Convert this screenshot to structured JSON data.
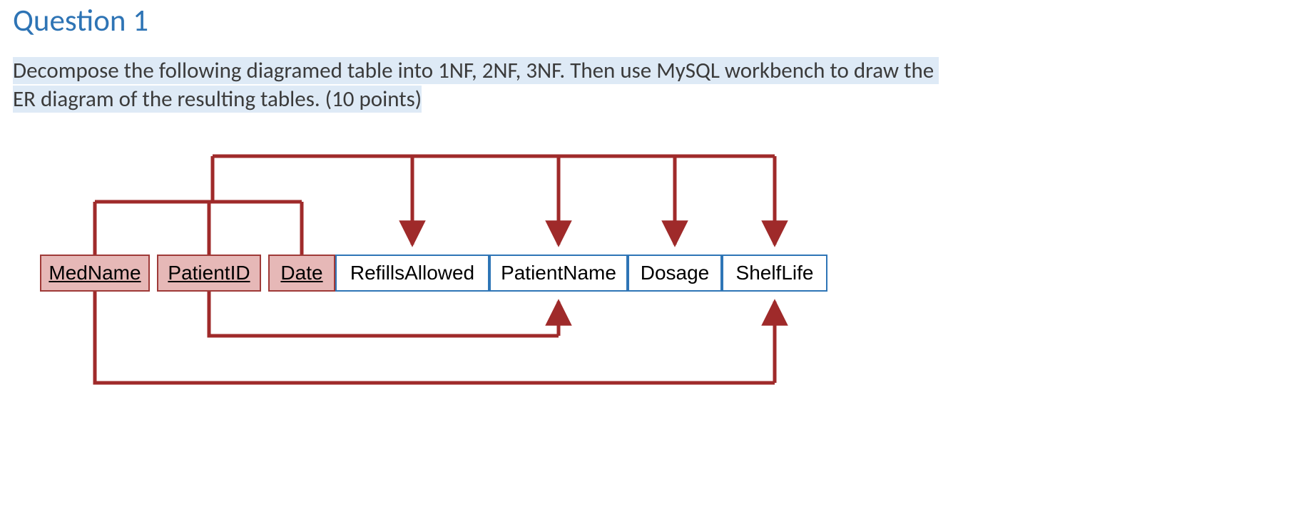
{
  "title": "Question 1",
  "prompt_line1": "Decompose the following diagramed table into 1NF, 2NF, 3NF. Then use MySQL workbench to draw the ",
  "prompt_line2a": "ER diagram of the resulting tables. (10 points)",
  "cells": {
    "medname": {
      "label": "MedName",
      "is_key": true
    },
    "patientid": {
      "label": "PatientID",
      "is_key": true
    },
    "date": {
      "label": "Date",
      "is_key": true
    },
    "refills": {
      "label": "RefillsAllowed",
      "is_key": false
    },
    "patientname": {
      "label": "PatientName",
      "is_key": false
    },
    "dosage": {
      "label": "Dosage",
      "is_key": false
    },
    "shelflife": {
      "label": "ShelfLife",
      "is_key": false
    }
  },
  "dependencies": [
    {
      "from": [
        "MedName",
        "PatientID",
        "Date"
      ],
      "to": [
        "RefillsAllowed",
        "PatientName",
        "Dosage",
        "ShelfLife"
      ],
      "route": "top-full"
    },
    {
      "from": [
        "MedName"
      ],
      "to": [
        "ShelfLife"
      ],
      "route": "bottom-outer"
    },
    {
      "from": [
        "PatientID"
      ],
      "to": [
        "PatientName"
      ],
      "route": "bottom-inner"
    }
  ],
  "arrow_color": "#9f2a2a"
}
